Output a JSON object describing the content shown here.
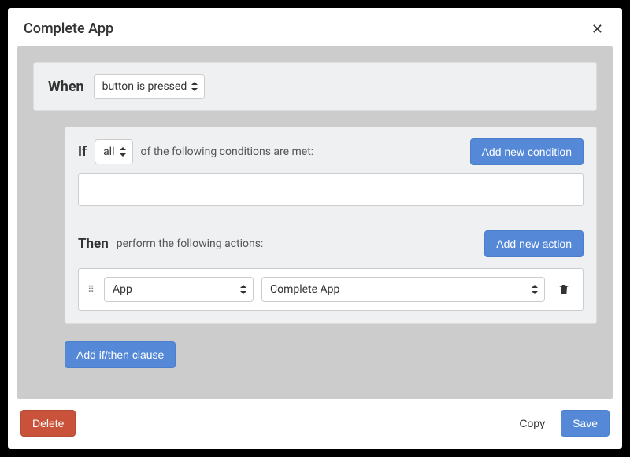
{
  "header": {
    "title": "Complete App"
  },
  "when": {
    "label": "When",
    "trigger": "button is pressed"
  },
  "if": {
    "label": "If",
    "quantifier": "all",
    "description": "of the following conditions are met:",
    "add_button": "Add new condition"
  },
  "then": {
    "label": "Then",
    "description": "perform the following actions:",
    "add_button": "Add new action",
    "actions": [
      {
        "target": "App",
        "action": "Complete App"
      }
    ]
  },
  "buttons": {
    "add_clause": "Add if/then clause",
    "delete": "Delete",
    "copy": "Copy",
    "save": "Save"
  }
}
